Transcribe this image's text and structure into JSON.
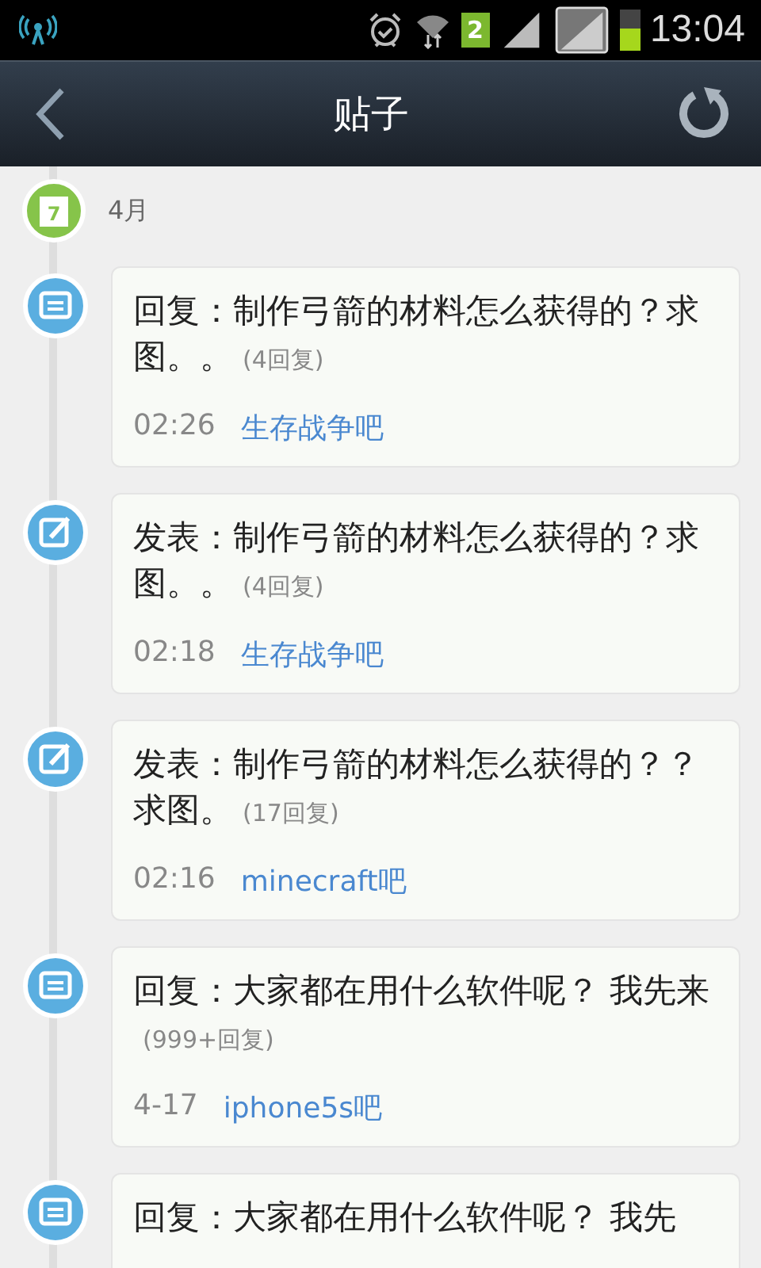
{
  "status_bar": {
    "sim_badge": "2",
    "time": "13:04"
  },
  "header": {
    "title": "贴子"
  },
  "month": {
    "label": "4月",
    "day_icon_text": "7"
  },
  "posts": [
    {
      "kind": "reply",
      "title": "回复：制作弓箭的材料怎么获得的？求图。。",
      "count": "(4回复)",
      "time": "02:26",
      "forum": "生存战争吧"
    },
    {
      "kind": "post",
      "title": "发表：制作弓箭的材料怎么获得的？求图。。",
      "count": "(4回复)",
      "time": "02:18",
      "forum": "生存战争吧"
    },
    {
      "kind": "post",
      "title": "发表：制作弓箭的材料怎么获得的？？求图。",
      "count": "(17回复)",
      "time": "02:16",
      "forum": "minecraft吧"
    },
    {
      "kind": "reply",
      "title": "回复：大家都在用什么软件呢？ 我先来",
      "count": "(999+回复)",
      "time": "4-17",
      "forum": "iphone5s吧"
    },
    {
      "kind": "reply",
      "title": "回复：大家都在用什么软件呢？ 我先"
    }
  ]
}
